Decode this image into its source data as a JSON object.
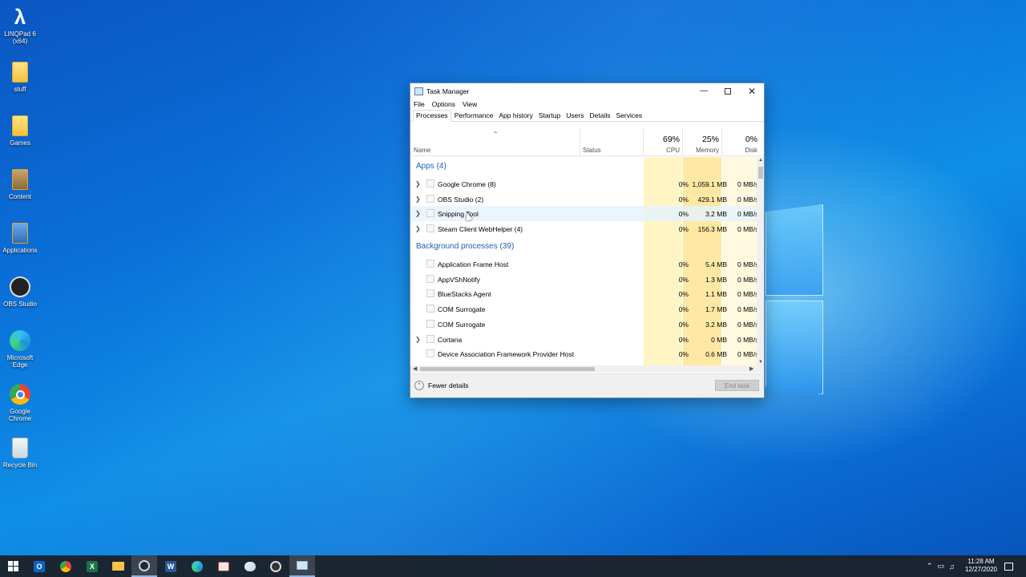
{
  "desktop": {
    "icons": [
      {
        "label": "LINQPad 6 (x64)",
        "icon": "linqpad-icon"
      },
      {
        "label": "stuff",
        "icon": "folder-icon"
      },
      {
        "label": "Games",
        "icon": "folder-icon"
      },
      {
        "label": "Content",
        "icon": "folder-icon"
      },
      {
        "label": "Applications",
        "icon": "folder-icon"
      },
      {
        "label": "OBS Studio",
        "icon": "obs-icon"
      },
      {
        "label": "Microsoft Edge",
        "icon": "edge-icon"
      },
      {
        "label": "Google Chrome",
        "icon": "chrome-icon"
      },
      {
        "label": "Recycle Bin",
        "icon": "recycle-bin-icon"
      }
    ]
  },
  "window": {
    "title": "Task Manager",
    "menu": [
      "File",
      "Options",
      "View"
    ],
    "tabs": [
      "Processes",
      "Performance",
      "App history",
      "Startup",
      "Users",
      "Details",
      "Services"
    ],
    "active_tab": "Processes"
  },
  "columns": {
    "name": "Name",
    "status": "Status",
    "cpu": {
      "pct": "69%",
      "label": "CPU"
    },
    "memory": {
      "pct": "25%",
      "label": "Memory"
    },
    "disk": {
      "pct": "0%",
      "label": "Disk"
    }
  },
  "groups": {
    "apps": "Apps (4)",
    "background": "Background processes (39)"
  },
  "apps": [
    {
      "name": "Google Chrome (8)",
      "cpu": "0%",
      "memory": "1,059.1 MB",
      "disk": "0 MB/s",
      "expandable": true
    },
    {
      "name": "OBS Studio (2)",
      "cpu": "0%",
      "memory": "429.1 MB",
      "disk": "0 MB/s",
      "expandable": true
    },
    {
      "name": "Snipping Tool",
      "cpu": "0%",
      "memory": "3.2 MB",
      "disk": "0 MB/s",
      "expandable": true
    },
    {
      "name": "Steam Client WebHelper (4)",
      "cpu": "0%",
      "memory": "156.3 MB",
      "disk": "0 MB/s",
      "expandable": true
    }
  ],
  "background": [
    {
      "name": "Application Frame Host",
      "cpu": "0%",
      "memory": "5.4 MB",
      "disk": "0 MB/s",
      "expandable": false
    },
    {
      "name": "AppVShNotify",
      "cpu": "0%",
      "memory": "1.3 MB",
      "disk": "0 MB/s",
      "expandable": false
    },
    {
      "name": "BlueStacks Agent",
      "cpu": "0%",
      "memory": "1.1 MB",
      "disk": "0 MB/s",
      "expandable": false
    },
    {
      "name": "COM Surrogate",
      "cpu": "0%",
      "memory": "1.7 MB",
      "disk": "0 MB/s",
      "expandable": false
    },
    {
      "name": "COM Surrogate",
      "cpu": "0%",
      "memory": "3.2 MB",
      "disk": "0 MB/s",
      "expandable": false
    },
    {
      "name": "Cortana",
      "cpu": "0%",
      "memory": "0 MB",
      "disk": "0 MB/s",
      "expandable": true
    },
    {
      "name": "Device Association Framework Provider Host",
      "cpu": "0%",
      "memory": "0.6 MB",
      "disk": "0 MB/s",
      "expandable": false
    }
  ],
  "footer": {
    "fewer_details": "Fewer details",
    "end_task": "End task"
  },
  "taskbar": {
    "apps": [
      "start-icon",
      "outlook-icon",
      "chrome-icon",
      "excel-icon",
      "file-explorer-icon",
      "steam-icon",
      "word-icon",
      "edge-icon",
      "snipping-tool-icon",
      "paint-icon",
      "obs-icon",
      "task-manager-icon"
    ],
    "time": "11:28 AM",
    "date": "12/27/2020"
  },
  "colors": {
    "cpu_highlight": "#fff4c4",
    "memory_highlight": "#ffe8a3",
    "group_text": "#1b5fb8",
    "taskbar": "#1c222c"
  }
}
